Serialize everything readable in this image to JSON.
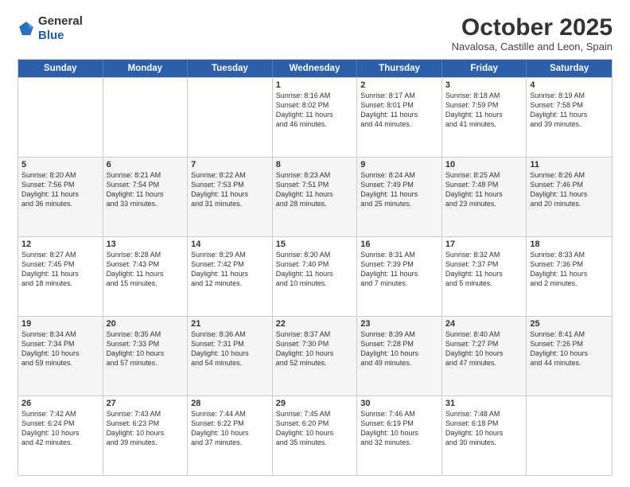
{
  "header": {
    "logo_general": "General",
    "logo_blue": "Blue",
    "title": "October 2025",
    "subtitle": "Navalosa, Castille and Leon, Spain"
  },
  "days_of_week": [
    "Sunday",
    "Monday",
    "Tuesday",
    "Wednesday",
    "Thursday",
    "Friday",
    "Saturday"
  ],
  "rows": [
    {
      "alt": false,
      "cells": [
        {
          "day": "",
          "detail": ""
        },
        {
          "day": "",
          "detail": ""
        },
        {
          "day": "",
          "detail": ""
        },
        {
          "day": "1",
          "detail": "Sunrise: 8:16 AM\nSunset: 8:02 PM\nDaylight: 11 hours\nand 46 minutes."
        },
        {
          "day": "2",
          "detail": "Sunrise: 8:17 AM\nSunset: 8:01 PM\nDaylight: 11 hours\nand 44 minutes."
        },
        {
          "day": "3",
          "detail": "Sunrise: 8:18 AM\nSunset: 7:59 PM\nDaylight: 11 hours\nand 41 minutes."
        },
        {
          "day": "4",
          "detail": "Sunrise: 8:19 AM\nSunset: 7:58 PM\nDaylight: 11 hours\nand 39 minutes."
        }
      ]
    },
    {
      "alt": true,
      "cells": [
        {
          "day": "5",
          "detail": "Sunrise: 8:20 AM\nSunset: 7:56 PM\nDaylight: 11 hours\nand 36 minutes."
        },
        {
          "day": "6",
          "detail": "Sunrise: 8:21 AM\nSunset: 7:54 PM\nDaylight: 11 hours\nand 33 minutes."
        },
        {
          "day": "7",
          "detail": "Sunrise: 8:22 AM\nSunset: 7:53 PM\nDaylight: 11 hours\nand 31 minutes."
        },
        {
          "day": "8",
          "detail": "Sunrise: 8:23 AM\nSunset: 7:51 PM\nDaylight: 11 hours\nand 28 minutes."
        },
        {
          "day": "9",
          "detail": "Sunrise: 8:24 AM\nSunset: 7:49 PM\nDaylight: 11 hours\nand 25 minutes."
        },
        {
          "day": "10",
          "detail": "Sunrise: 8:25 AM\nSunset: 7:48 PM\nDaylight: 11 hours\nand 23 minutes."
        },
        {
          "day": "11",
          "detail": "Sunrise: 8:26 AM\nSunset: 7:46 PM\nDaylight: 11 hours\nand 20 minutes."
        }
      ]
    },
    {
      "alt": false,
      "cells": [
        {
          "day": "12",
          "detail": "Sunrise: 8:27 AM\nSunset: 7:45 PM\nDaylight: 11 hours\nand 18 minutes."
        },
        {
          "day": "13",
          "detail": "Sunrise: 8:28 AM\nSunset: 7:43 PM\nDaylight: 11 hours\nand 15 minutes."
        },
        {
          "day": "14",
          "detail": "Sunrise: 8:29 AM\nSunset: 7:42 PM\nDaylight: 11 hours\nand 12 minutes."
        },
        {
          "day": "15",
          "detail": "Sunrise: 8:30 AM\nSunset: 7:40 PM\nDaylight: 11 hours\nand 10 minutes."
        },
        {
          "day": "16",
          "detail": "Sunrise: 8:31 AM\nSunset: 7:39 PM\nDaylight: 11 hours\nand 7 minutes."
        },
        {
          "day": "17",
          "detail": "Sunrise: 8:32 AM\nSunset: 7:37 PM\nDaylight: 11 hours\nand 5 minutes."
        },
        {
          "day": "18",
          "detail": "Sunrise: 8:33 AM\nSunset: 7:36 PM\nDaylight: 11 hours\nand 2 minutes."
        }
      ]
    },
    {
      "alt": true,
      "cells": [
        {
          "day": "19",
          "detail": "Sunrise: 8:34 AM\nSunset: 7:34 PM\nDaylight: 10 hours\nand 59 minutes."
        },
        {
          "day": "20",
          "detail": "Sunrise: 8:35 AM\nSunset: 7:33 PM\nDaylight: 10 hours\nand 57 minutes."
        },
        {
          "day": "21",
          "detail": "Sunrise: 8:36 AM\nSunset: 7:31 PM\nDaylight: 10 hours\nand 54 minutes."
        },
        {
          "day": "22",
          "detail": "Sunrise: 8:37 AM\nSunset: 7:30 PM\nDaylight: 10 hours\nand 52 minutes."
        },
        {
          "day": "23",
          "detail": "Sunrise: 8:39 AM\nSunset: 7:28 PM\nDaylight: 10 hours\nand 49 minutes."
        },
        {
          "day": "24",
          "detail": "Sunrise: 8:40 AM\nSunset: 7:27 PM\nDaylight: 10 hours\nand 47 minutes."
        },
        {
          "day": "25",
          "detail": "Sunrise: 8:41 AM\nSunset: 7:26 PM\nDaylight: 10 hours\nand 44 minutes."
        }
      ]
    },
    {
      "alt": false,
      "cells": [
        {
          "day": "26",
          "detail": "Sunrise: 7:42 AM\nSunset: 6:24 PM\nDaylight: 10 hours\nand 42 minutes."
        },
        {
          "day": "27",
          "detail": "Sunrise: 7:43 AM\nSunset: 6:23 PM\nDaylight: 10 hours\nand 39 minutes."
        },
        {
          "day": "28",
          "detail": "Sunrise: 7:44 AM\nSunset: 6:22 PM\nDaylight: 10 hours\nand 37 minutes."
        },
        {
          "day": "29",
          "detail": "Sunrise: 7:45 AM\nSunset: 6:20 PM\nDaylight: 10 hours\nand 35 minutes."
        },
        {
          "day": "30",
          "detail": "Sunrise: 7:46 AM\nSunset: 6:19 PM\nDaylight: 10 hours\nand 32 minutes."
        },
        {
          "day": "31",
          "detail": "Sunrise: 7:48 AM\nSunset: 6:18 PM\nDaylight: 10 hours\nand 30 minutes."
        },
        {
          "day": "",
          "detail": ""
        }
      ]
    }
  ]
}
